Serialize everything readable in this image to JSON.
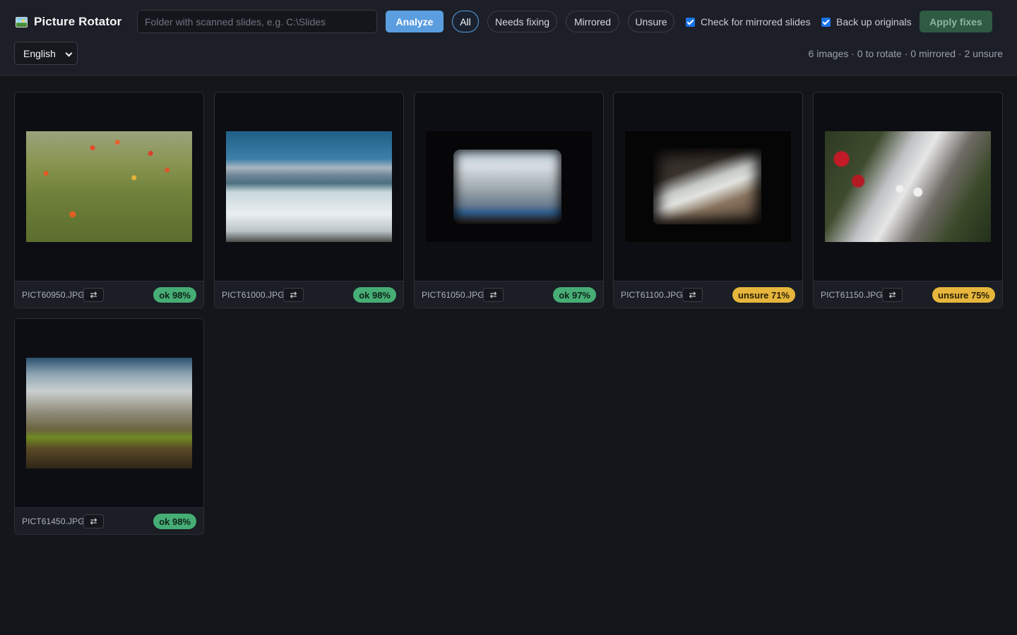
{
  "app": {
    "title": "Picture Rotator"
  },
  "toolbar": {
    "folder_placeholder": "Folder with scanned slides, e.g. C:\\Slides",
    "folder_value": "",
    "analyze_label": "Analyze",
    "filters": [
      {
        "label": "All",
        "active": true
      },
      {
        "label": "Needs fixing",
        "active": false
      },
      {
        "label": "Mirrored",
        "active": false
      },
      {
        "label": "Unsure",
        "active": false
      }
    ],
    "check_mirrored_label": "Check for mirrored slides",
    "check_mirrored_checked": true,
    "backup_label": "Back up originals",
    "backup_checked": true,
    "apply_label": "Apply fixes",
    "language": "English",
    "summary": "6 images · 0 to rotate · 0 mirrored · 2 unsure"
  },
  "cards": [
    {
      "filename": "PICT60950.JPG",
      "status": "ok",
      "badge": "ok 98%",
      "flip_icon": "swap-arrows-icon"
    },
    {
      "filename": "PICT61000.JPG",
      "status": "ok",
      "badge": "ok 98%",
      "flip_icon": "swap-arrows-icon"
    },
    {
      "filename": "PICT61050.JPG",
      "status": "ok",
      "badge": "ok 97%",
      "flip_icon": "swap-arrows-icon"
    },
    {
      "filename": "PICT61100.JPG",
      "status": "unsure",
      "badge": "unsure 71%",
      "flip_icon": "swap-arrows-icon"
    },
    {
      "filename": "PICT61150.JPG",
      "status": "unsure",
      "badge": "unsure 75%",
      "flip_icon": "swap-arrows-icon"
    },
    {
      "filename": "PICT61450.JPG",
      "status": "ok",
      "badge": "ok 98%",
      "flip_icon": "swap-arrows-icon"
    }
  ],
  "colors": {
    "accent": "#5a9ee0",
    "ok": "#46ad75",
    "unsure": "#e6b53c",
    "apply": "#2f5b43",
    "background": "#15161b"
  }
}
